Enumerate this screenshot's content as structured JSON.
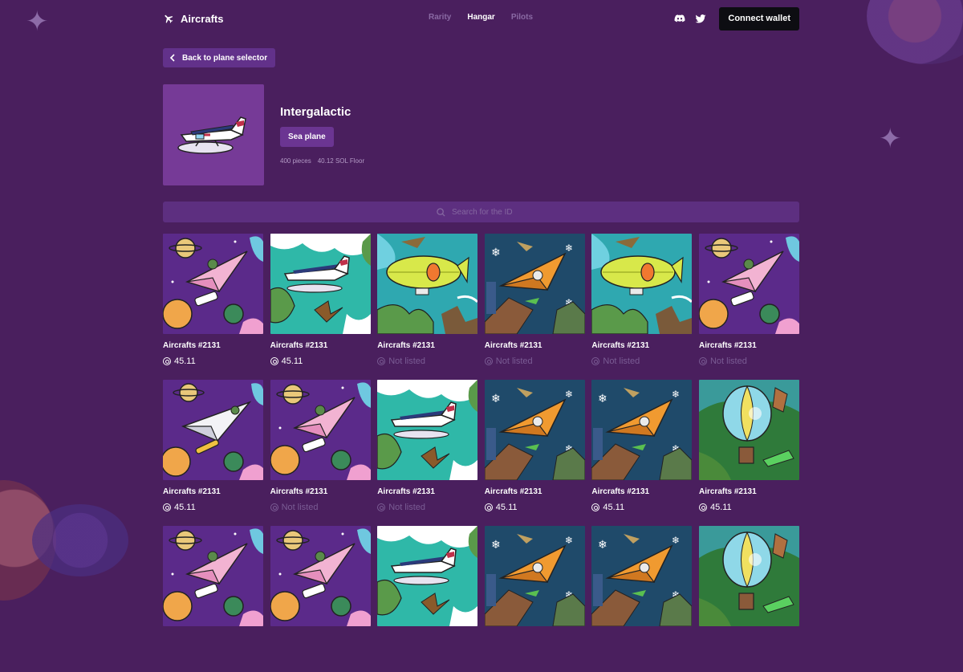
{
  "header": {
    "logo_text": "Aircrafts",
    "nav": [
      {
        "label": "Rarity",
        "active": false
      },
      {
        "label": "Hangar",
        "active": true
      },
      {
        "label": "Pilots",
        "active": false
      }
    ],
    "connect_label": "Connect wallet",
    "social_icons": [
      "discord-icon",
      "twitter-icon"
    ]
  },
  "back_label": "Back to plane selector",
  "collection": {
    "title": "Intergalactic",
    "type": "Sea plane",
    "pieces": "400 pieces",
    "floor": "40.12 SOL Floor"
  },
  "search": {
    "placeholder": "Search for the ID"
  },
  "colors": {
    "background": "#4a1f5e",
    "cover": "#763a97",
    "search_bg": "#5d2f80",
    "unlisted": "#7a5c94"
  },
  "items": [
    {
      "name": "Aircrafts #2131",
      "price": "45.11",
      "art": "space-pink"
    },
    {
      "name": "Aircrafts #2131",
      "price": "45.11",
      "art": "seaplane"
    },
    {
      "name": "Aircrafts #2131",
      "price": "Not listed",
      "art": "blimp"
    },
    {
      "name": "Aircrafts #2131",
      "price": "Not listed",
      "art": "orange-night"
    },
    {
      "name": "Aircrafts #2131",
      "price": "Not listed",
      "art": "blimp"
    },
    {
      "name": "Aircrafts #2131",
      "price": "Not listed",
      "art": "space-pink"
    },
    {
      "name": "Aircrafts #2131",
      "price": "45.11",
      "art": "space-white"
    },
    {
      "name": "Aircrafts #2131",
      "price": "Not listed",
      "art": "space-pink"
    },
    {
      "name": "Aircrafts #2131",
      "price": "Not listed",
      "art": "seaplane"
    },
    {
      "name": "Aircrafts #2131",
      "price": "45.11",
      "art": "orange-night"
    },
    {
      "name": "Aircrafts #2131",
      "price": "45.11",
      "art": "orange-night"
    },
    {
      "name": "Aircrafts #2131",
      "price": "45.11",
      "art": "balloon"
    },
    {
      "name": "",
      "price": "",
      "art": "space-pink"
    },
    {
      "name": "",
      "price": "",
      "art": "space-pink"
    },
    {
      "name": "",
      "price": "",
      "art": "seaplane"
    },
    {
      "name": "",
      "price": "",
      "art": "orange-night"
    },
    {
      "name": "",
      "price": "",
      "art": "orange-night"
    },
    {
      "name": "",
      "price": "",
      "art": "balloon"
    }
  ]
}
